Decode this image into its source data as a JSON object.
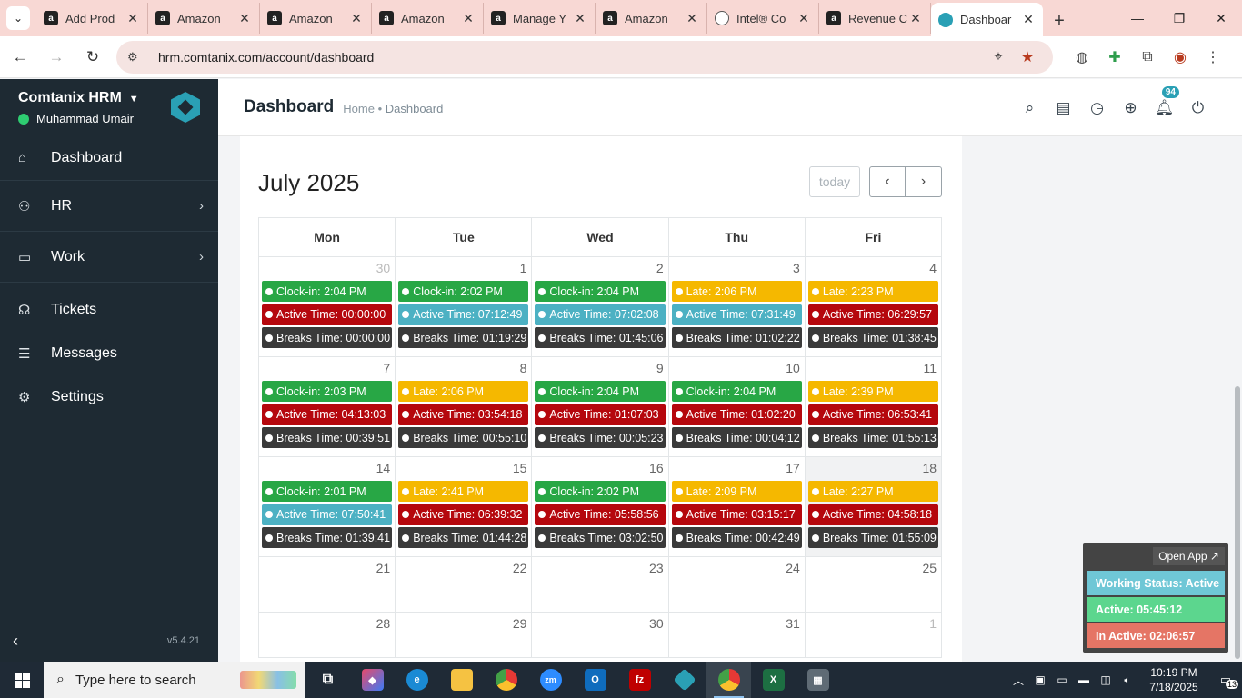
{
  "browser": {
    "tabs": [
      {
        "title": "Add Prod",
        "favicon": "amazon-icon"
      },
      {
        "title": "Amazon",
        "favicon": "amazon-icon"
      },
      {
        "title": "Amazon",
        "favicon": "amazon-icon"
      },
      {
        "title": "Amazon",
        "favicon": "amazon-icon"
      },
      {
        "title": "Manage Y",
        "favicon": "amazon-icon"
      },
      {
        "title": "Amazon",
        "favicon": "amazon-icon"
      },
      {
        "title": "Intel® Co",
        "favicon": "intel-icon"
      },
      {
        "title": "Revenue C",
        "favicon": "amazon-icon"
      },
      {
        "title": "Dashboar",
        "favicon": "comtanix-icon"
      }
    ],
    "url": "hrm.comtanix.com/account/dashboard"
  },
  "sidebar": {
    "brand": "Comtanix HRM",
    "user": "Muhammad Umair",
    "items": [
      {
        "label": "Dashboard",
        "icon": "home-icon"
      },
      {
        "label": "HR",
        "icon": "users-icon"
      },
      {
        "label": "Work",
        "icon": "briefcase-icon"
      },
      {
        "label": "Tickets",
        "icon": "headset-icon"
      },
      {
        "label": "Messages",
        "icon": "message-icon"
      },
      {
        "label": "Settings",
        "icon": "gear-icon"
      }
    ],
    "version": "v5.4.21"
  },
  "header": {
    "title": "Dashboard",
    "breadcrumb_home": "Home",
    "breadcrumb_sep": "•",
    "breadcrumb_current": "Dashboard",
    "notification_count": "94"
  },
  "calendar": {
    "title": "July 2025",
    "today_label": "today",
    "weekdays": [
      "Mon",
      "Tue",
      "Wed",
      "Thu",
      "Fri"
    ],
    "weeks": [
      {
        "days": [
          {
            "num": "30",
            "other": true,
            "events": [
              {
                "text": "Clock-in: 2:04 PM",
                "color": "green"
              },
              {
                "text": "Active Time: 00:00:00",
                "color": "red"
              },
              {
                "text": "Breaks Time: 00:00:00",
                "color": "dark"
              }
            ]
          },
          {
            "num": "1",
            "events": [
              {
                "text": "Clock-in: 2:02 PM",
                "color": "green"
              },
              {
                "text": "Active Time: 07:12:49",
                "color": "teal"
              },
              {
                "text": "Breaks Time: 01:19:29",
                "color": "dark"
              }
            ]
          },
          {
            "num": "2",
            "events": [
              {
                "text": "Clock-in: 2:04 PM",
                "color": "green"
              },
              {
                "text": "Active Time: 07:02:08",
                "color": "teal"
              },
              {
                "text": "Breaks Time: 01:45:06",
                "color": "dark"
              }
            ]
          },
          {
            "num": "3",
            "events": [
              {
                "text": "Late: 2:06 PM",
                "color": "yellow"
              },
              {
                "text": "Active Time: 07:31:49",
                "color": "teal"
              },
              {
                "text": "Breaks Time: 01:02:22",
                "color": "dark"
              }
            ]
          },
          {
            "num": "4",
            "events": [
              {
                "text": "Late: 2:23 PM",
                "color": "yellow"
              },
              {
                "text": "Active Time: 06:29:57",
                "color": "red"
              },
              {
                "text": "Breaks Time: 01:38:45",
                "color": "dark"
              }
            ]
          }
        ]
      },
      {
        "days": [
          {
            "num": "7",
            "events": [
              {
                "text": "Clock-in: 2:03 PM",
                "color": "green"
              },
              {
                "text": "Active Time: 04:13:03",
                "color": "red"
              },
              {
                "text": "Breaks Time: 00:39:51",
                "color": "dark"
              }
            ]
          },
          {
            "num": "8",
            "events": [
              {
                "text": "Late: 2:06 PM",
                "color": "yellow"
              },
              {
                "text": "Active Time: 03:54:18",
                "color": "red"
              },
              {
                "text": "Breaks Time: 00:55:10",
                "color": "dark"
              }
            ]
          },
          {
            "num": "9",
            "events": [
              {
                "text": "Clock-in: 2:04 PM",
                "color": "green"
              },
              {
                "text": "Active Time: 01:07:03",
                "color": "red"
              },
              {
                "text": "Breaks Time: 00:05:23",
                "color": "dark"
              }
            ]
          },
          {
            "num": "10",
            "events": [
              {
                "text": "Clock-in: 2:04 PM",
                "color": "green"
              },
              {
                "text": "Active Time: 01:02:20",
                "color": "red"
              },
              {
                "text": "Breaks Time: 00:04:12",
                "color": "dark"
              }
            ]
          },
          {
            "num": "11",
            "events": [
              {
                "text": "Late: 2:39 PM",
                "color": "yellow"
              },
              {
                "text": "Active Time: 06:53:41",
                "color": "red"
              },
              {
                "text": "Breaks Time: 01:55:13",
                "color": "dark"
              }
            ]
          }
        ]
      },
      {
        "days": [
          {
            "num": "14",
            "events": [
              {
                "text": "Clock-in: 2:01 PM",
                "color": "green"
              },
              {
                "text": "Active Time: 07:50:41",
                "color": "teal"
              },
              {
                "text": "Breaks Time: 01:39:41",
                "color": "dark"
              }
            ]
          },
          {
            "num": "15",
            "events": [
              {
                "text": "Late: 2:41 PM",
                "color": "yellow"
              },
              {
                "text": "Active Time: 06:39:32",
                "color": "red"
              },
              {
                "text": "Breaks Time: 01:44:28",
                "color": "dark"
              }
            ]
          },
          {
            "num": "16",
            "events": [
              {
                "text": "Clock-in: 2:02 PM",
                "color": "green"
              },
              {
                "text": "Active Time: 05:58:56",
                "color": "red"
              },
              {
                "text": "Breaks Time: 03:02:50",
                "color": "dark"
              }
            ]
          },
          {
            "num": "17",
            "events": [
              {
                "text": "Late: 2:09 PM",
                "color": "yellow"
              },
              {
                "text": "Active Time: 03:15:17",
                "color": "red"
              },
              {
                "text": "Breaks Time: 00:42:49",
                "color": "dark"
              }
            ]
          },
          {
            "num": "18",
            "today": true,
            "events": [
              {
                "text": "Late: 2:27 PM",
                "color": "yellow"
              },
              {
                "text": "Active Time: 04:58:18",
                "color": "red"
              },
              {
                "text": "Breaks Time: 01:55:09",
                "color": "dark"
              }
            ]
          }
        ]
      },
      {
        "days": [
          {
            "num": "21",
            "events": []
          },
          {
            "num": "22",
            "events": []
          },
          {
            "num": "23",
            "events": []
          },
          {
            "num": "24",
            "events": []
          },
          {
            "num": "25",
            "events": []
          }
        ]
      },
      {
        "days": [
          {
            "num": "28",
            "events": []
          },
          {
            "num": "29",
            "events": []
          },
          {
            "num": "30",
            "events": []
          },
          {
            "num": "31",
            "events": []
          },
          {
            "num": "1",
            "other": true,
            "events": []
          }
        ]
      }
    ]
  },
  "widget": {
    "open_app": "Open App ↗",
    "status": "Working Status: Active",
    "active": "Active: 05:45:12",
    "inactive": "In Active: 02:06:57"
  },
  "taskbar": {
    "search_placeholder": "Type here to search",
    "time": "10:19 PM",
    "date": "7/18/2025",
    "notifications": "13"
  },
  "colors": {
    "sidebar": "#1e2a33",
    "green": "#28a745",
    "yellow": "#f5b800",
    "red": "#b5070d",
    "teal": "#4cb1c3",
    "dark": "#3a3a3a"
  }
}
